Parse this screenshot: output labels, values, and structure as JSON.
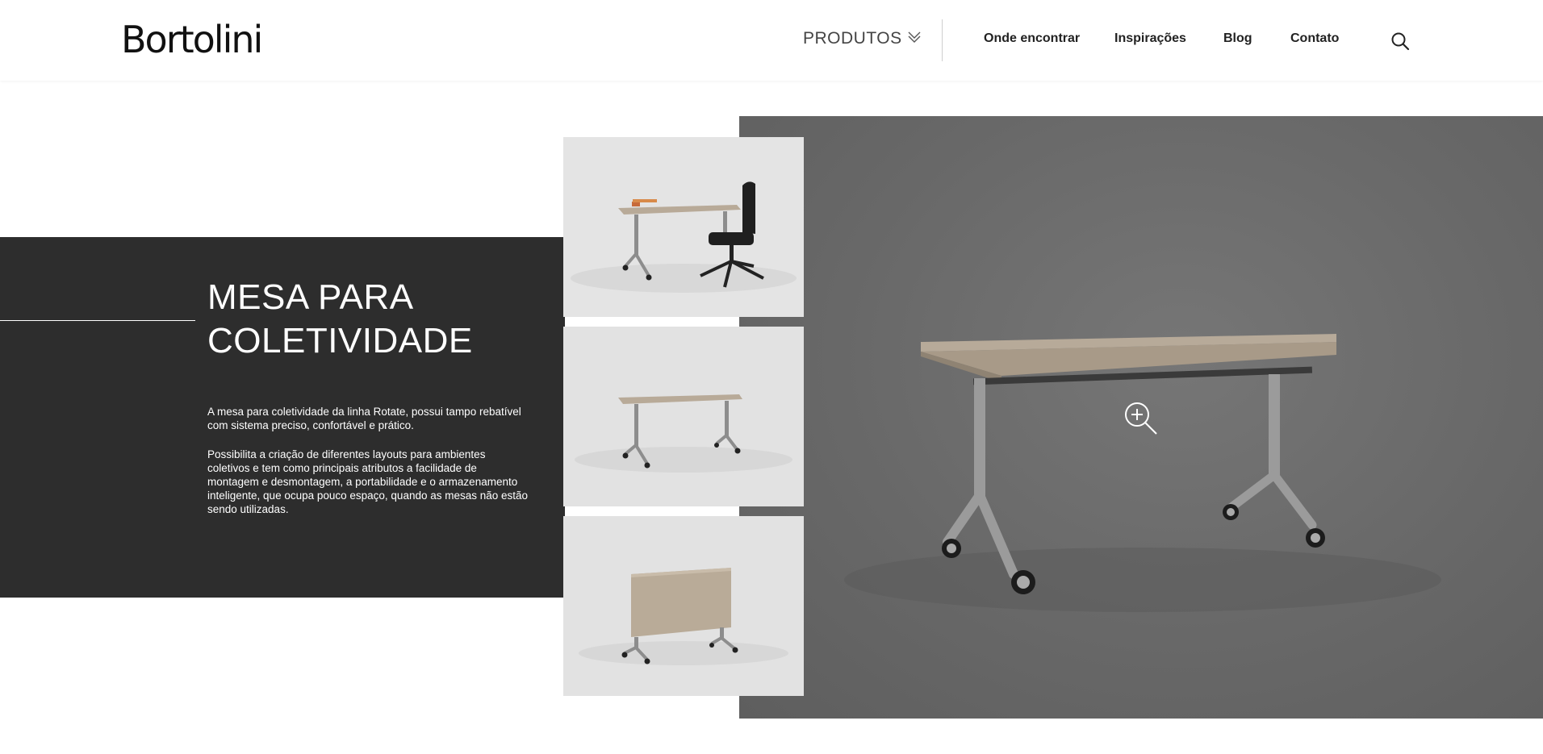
{
  "header": {
    "logo": "Bortolini",
    "nav": {
      "products": "PRODUTOS",
      "where": "Onde encontrar",
      "inspirations": "Inspirações",
      "blog": "Blog",
      "contact": "Contato"
    }
  },
  "hero": {
    "title_line1": "MESA PARA",
    "title_line2": "COLETIVIDADE",
    "paragraph1": "A mesa para coletividade da linha Rotate, possui tampo rebatível com sistema preciso, confortável e prático.",
    "paragraph2": "Possibilita a criação de diferentes layouts para ambientes coletivos e tem como principais atributos a facilidade de montagem e desmontagem, a portabilidade e o armazenamento inteligente, que ocupa pouco espaço, quando as mesas não estão sendo utilizadas."
  },
  "colors": {
    "dark_panel": "#2d2d2d",
    "hero_bg": "#6a6a6a",
    "tabletop": "#a89a88"
  },
  "icons": [
    "chevron-down-icon",
    "search-icon",
    "zoom-in-icon"
  ]
}
